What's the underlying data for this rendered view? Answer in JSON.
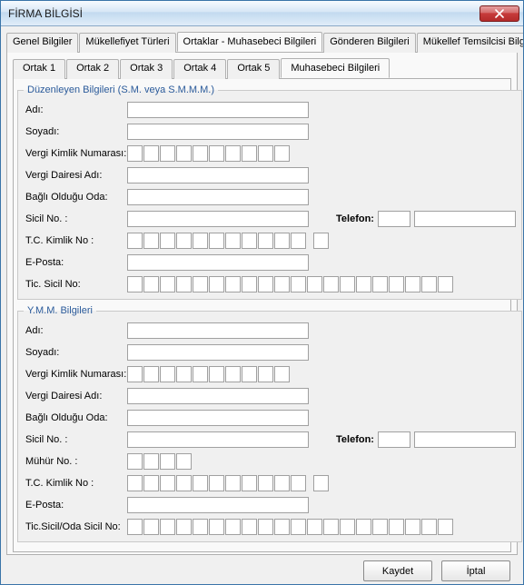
{
  "window": {
    "title": "FİRMA BİLGİSİ"
  },
  "mainTabs": {
    "t0": "Genel Bilgiler",
    "t1": "Mükellefiyet Türleri",
    "t2": "Ortaklar - Muhasebeci Bilgileri",
    "t3": "Gönderen Bilgileri",
    "t4": "Mükellef Temsilcisi Bilgileri",
    "activeIndex": 2
  },
  "subTabs": {
    "s0": "Ortak 1",
    "s1": "Ortak 2",
    "s2": "Ortak 3",
    "s3": "Ortak 4",
    "s4": "Ortak 5",
    "s5": "Muhasebeci Bilgileri",
    "activeIndex": 5
  },
  "group1": {
    "legend": "Düzenleyen Bilgileri (S.M. veya S.M.M.M.)",
    "labels": {
      "adi": "Adı:",
      "soyadi": "Soyadı:",
      "vkn": "Vergi Kimlik Numarası:",
      "vdaire": "Vergi Dairesi Adı:",
      "oda": "Bağlı Olduğu Oda:",
      "sicil": "Sicil No. :",
      "telefon": "Telefon:",
      "tckn": "T.C. Kimlik No :",
      "eposta": "E-Posta:",
      "ticsicil": "Tic. Sicil No:"
    },
    "values": {
      "adi": "",
      "soyadi": "",
      "vknDigits": [
        "",
        "",
        "",
        "",
        "",
        "",
        "",
        "",
        "",
        ""
      ],
      "vdaire": "",
      "oda": "",
      "sicil": "",
      "telA": "",
      "telB": "",
      "tcknDigits": [
        "",
        "",
        "",
        "",
        "",
        "",
        "",
        "",
        "",
        "",
        "",
        ""
      ],
      "eposta": "",
      "ticSicilDigits": [
        "",
        "",
        "",
        "",
        "",
        "",
        "",
        "",
        "",
        "",
        "",
        "",
        "",
        "",
        "",
        "",
        "",
        "",
        "",
        ""
      ]
    }
  },
  "group2": {
    "legend": "Y.M.M. Bilgileri",
    "labels": {
      "adi": "Adı:",
      "soyadi": "Soyadı:",
      "vkn": "Vergi Kimlik Numarası:",
      "vdaire": "Vergi Dairesi Adı:",
      "oda": "Bağlı Olduğu Oda:",
      "sicil": "Sicil No. :",
      "telefon": "Telefon:",
      "muhur": "Mühür No. :",
      "tckn": "T.C. Kimlik No :",
      "eposta": "E-Posta:",
      "ticodasicil": "Tic.Sicil/Oda Sicil No:"
    },
    "values": {
      "adi": "",
      "soyadi": "",
      "vknDigits": [
        "",
        "",
        "",
        "",
        "",
        "",
        "",
        "",
        "",
        ""
      ],
      "vdaire": "",
      "oda": "",
      "sicil": "",
      "telA": "",
      "telB": "",
      "muhurDigits": [
        "",
        "",
        "",
        ""
      ],
      "tcknDigits": [
        "",
        "",
        "",
        "",
        "",
        "",
        "",
        "",
        "",
        "",
        "",
        ""
      ],
      "eposta": "",
      "ticOdaSicilDigits": [
        "",
        "",
        "",
        "",
        "",
        "",
        "",
        "",
        "",
        "",
        "",
        "",
        "",
        "",
        "",
        "",
        "",
        "",
        "",
        ""
      ]
    }
  },
  "footer": {
    "save": "Kaydet",
    "cancel": "İptal"
  }
}
